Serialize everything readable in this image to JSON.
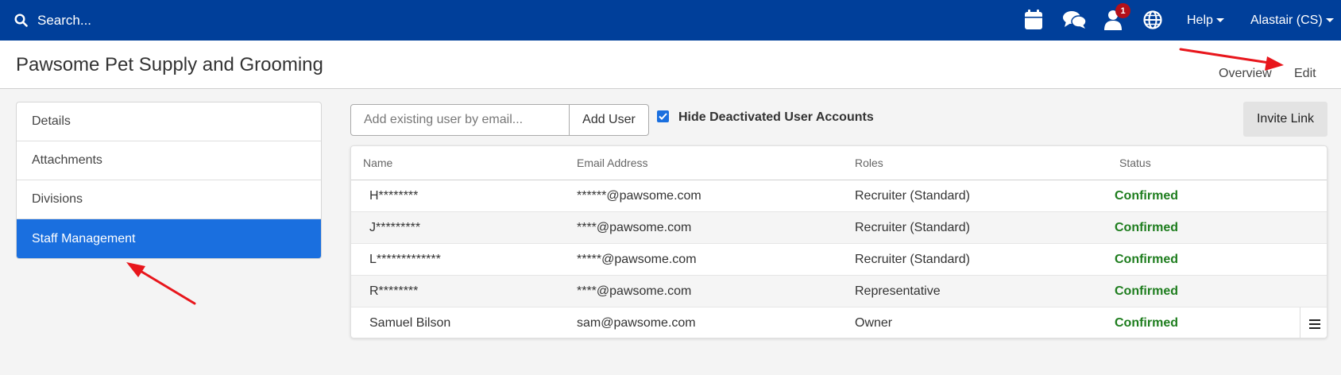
{
  "topbar": {
    "search_placeholder": "Search...",
    "icons": [
      "calendar-icon",
      "chat-icon",
      "user-icon",
      "globe-icon"
    ],
    "notification_count": "1",
    "help_label": "Help",
    "user_label": "Alastair (CS)"
  },
  "header": {
    "title": "Pawsome Pet Supply and Grooming",
    "overview_link": "Overview",
    "edit_link": "Edit"
  },
  "sidebar": {
    "items": [
      {
        "label": "Details",
        "active": false
      },
      {
        "label": "Attachments",
        "active": false
      },
      {
        "label": "Divisions",
        "active": false
      },
      {
        "label": "Staff Management",
        "active": true
      }
    ]
  },
  "toolbar": {
    "email_placeholder": "Add existing user by email...",
    "add_user_label": "Add User",
    "hide_deactivated_label": "Hide Deactivated User Accounts",
    "hide_deactivated_checked": true,
    "invite_link_label": "Invite Link"
  },
  "table": {
    "headers": [
      "Name",
      "Email Address",
      "Roles",
      "Status"
    ],
    "rows": [
      {
        "name": "H********",
        "email": "******@pawsome.com",
        "role": "Recruiter (Standard)",
        "status": "Confirmed"
      },
      {
        "name": "J*********",
        "email": "****@pawsome.com",
        "role": "Recruiter (Standard)",
        "status": "Confirmed"
      },
      {
        "name": "L*************",
        "email": "*****@pawsome.com",
        "role": "Recruiter (Standard)",
        "status": "Confirmed"
      },
      {
        "name": "R********",
        "email": "****@pawsome.com",
        "role": "Representative",
        "status": "Confirmed"
      },
      {
        "name": "Samuel Bilson",
        "email": "sam@pawsome.com",
        "role": "Owner",
        "status": "Confirmed"
      }
    ]
  },
  "colors": {
    "topbar": "#003f9a",
    "active_item": "#1a6fdf",
    "status_confirmed": "#1e7d1e",
    "badge": "#b3101a",
    "annotation_arrow": "#e8161c"
  }
}
